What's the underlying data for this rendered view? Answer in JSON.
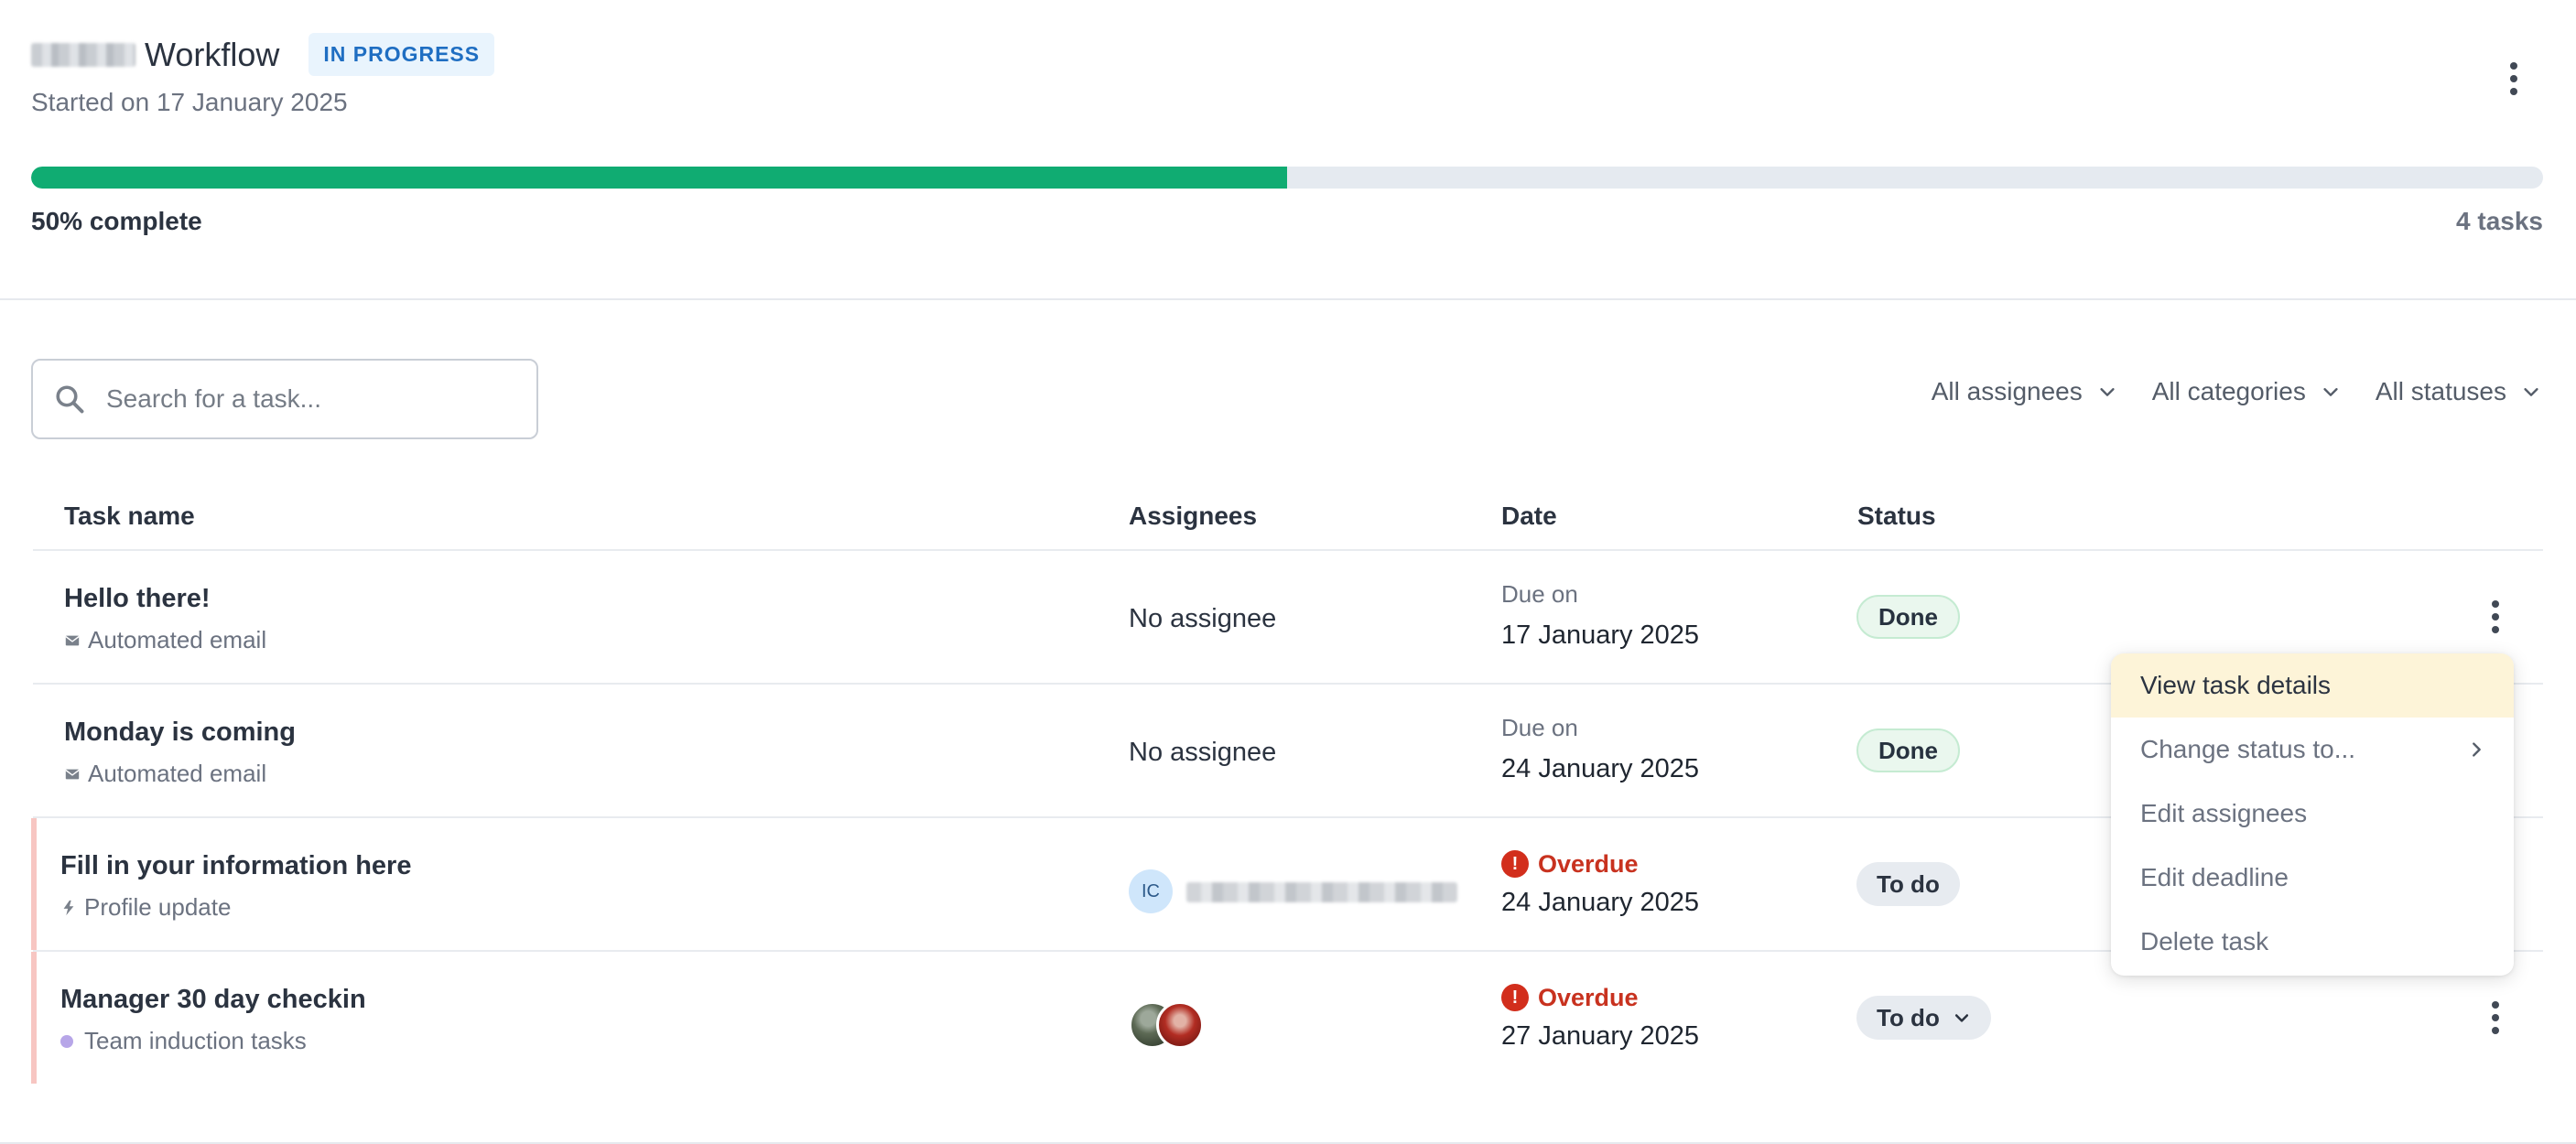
{
  "header": {
    "title": "Workflow",
    "status_badge": "IN PROGRESS",
    "started": "Started on 17 January 2025",
    "progress_percent": 50,
    "progress_label": "50% complete",
    "task_count": "4 tasks"
  },
  "filters": {
    "search_placeholder": "Search for a task...",
    "assignees": "All assignees",
    "categories": "All categories",
    "statuses": "All statuses"
  },
  "table": {
    "columns": [
      "Task name",
      "Assignees",
      "Date",
      "Status"
    ],
    "rows": [
      {
        "name": "Hello there!",
        "category": "Automated email",
        "category_icon": "mail-icon",
        "assignee": "No assignee",
        "date_label": "Due on",
        "date": "17 January 2025",
        "status": "Done"
      },
      {
        "name": "Monday is coming",
        "category": "Automated email",
        "category_icon": "mail-icon",
        "assignee": "No assignee",
        "date_label": "Due on",
        "date": "24 January 2025",
        "status": "Done"
      },
      {
        "name": "Fill in your information here",
        "category": "Profile update",
        "category_icon": "lightning-icon",
        "assignee_initials": "IC",
        "date_label": "Overdue",
        "date": "24 January 2025",
        "status": "To do"
      },
      {
        "name": "Manager 30 day checkin",
        "category": "Team induction tasks",
        "category_icon": "dot-icon",
        "date_label": "Overdue",
        "date": "27 January 2025",
        "status": "To do"
      }
    ]
  },
  "context_menu": {
    "items": [
      "View task details",
      "Change status to...",
      "Edit assignees",
      "Edit deadline",
      "Delete task"
    ]
  },
  "colors": {
    "progress": "#10ac72",
    "overdue": "#d22e1c",
    "badge_bg": "#e9f4fd",
    "badge_text": "#1f6ec2",
    "menu_highlight": "#fdf4d8"
  }
}
